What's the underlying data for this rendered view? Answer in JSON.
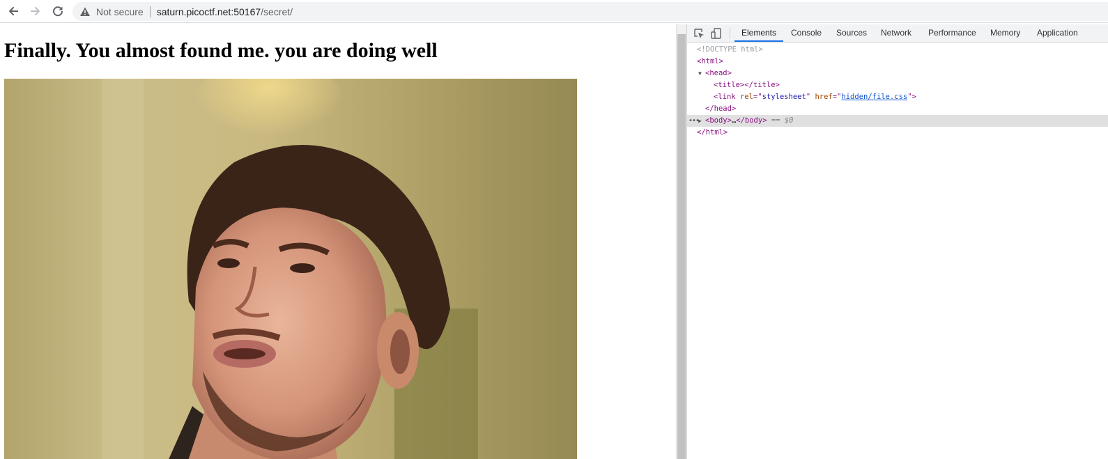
{
  "browser": {
    "security_label": "Not secure",
    "url_host": "saturn.picoctf.net:50167",
    "url_path": "/secret/"
  },
  "page": {
    "heading": "Finally. You almost found me. you are doing well"
  },
  "devtools": {
    "tabs": [
      "Elements",
      "Console",
      "Sources",
      "Network",
      "Performance",
      "Memory",
      "Application"
    ],
    "active_tab": "Elements",
    "dom": {
      "doctype": "<!DOCTYPE html>",
      "html_open": "<html>",
      "head_open": "<head>",
      "title_open": "<title>",
      "title_close": "</title>",
      "link_tag_open": "<link",
      "link_rel_attr": "rel",
      "link_rel_value": "stylesheet",
      "link_href_attr": "href",
      "link_href_value": "hidden/file.css",
      "link_tag_close": ">",
      "head_close": "</head>",
      "body_open": "<body>",
      "body_ellipsis": "…",
      "body_close": "</body>",
      "selected_marker": "== $0",
      "html_close": "</html>"
    }
  },
  "colors": {
    "accent": "#1a73e8",
    "tag": "#881280",
    "attr_name": "#994500",
    "attr_value": "#1a1aa6"
  }
}
